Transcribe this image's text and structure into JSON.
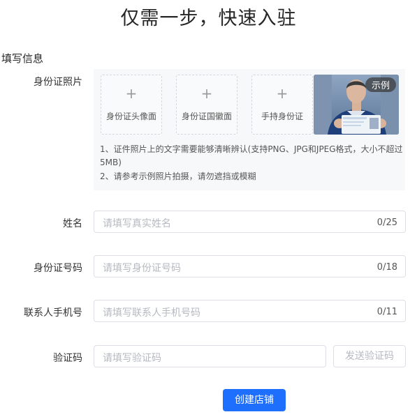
{
  "page": {
    "title": "仅需一步，快速入驻"
  },
  "section": {
    "title": "填写信息"
  },
  "photo": {
    "label": "身份证照片",
    "uploads": [
      {
        "label": "身份证头像面"
      },
      {
        "label": "身份证国徽面"
      },
      {
        "label": "手持身份证"
      }
    ],
    "plus_glyph": "+",
    "example_badge": "示例",
    "notes": [
      "1、证件照片上的文字需要能够清晰辨认(支持PNG、JPG和JPEG格式，大小不超过",
      "5MB)",
      "2、请参考示例照片拍摄，请勿遮挡或模糊"
    ]
  },
  "fields": {
    "name": {
      "label": "姓名",
      "placeholder": "请填写真实姓名",
      "counter": "0/25"
    },
    "id_number": {
      "label": "身份证号码",
      "placeholder": "请填写身份证号码",
      "counter": "0/18"
    },
    "phone": {
      "label": "联系人手机号",
      "placeholder": "请填写联系人手机号码",
      "counter": "0/11"
    },
    "code": {
      "label": "验证码",
      "placeholder": "请填写验证码",
      "send_button": "发送验证码"
    }
  },
  "submit": {
    "label": "创建店铺"
  },
  "colors": {
    "primary": "#1f6fff",
    "border": "#dcdfe6",
    "placeholder": "#b6b9c0",
    "panel": "#f7f8fa"
  },
  "icons": [
    "plus-icon",
    "id-card-example-image"
  ]
}
